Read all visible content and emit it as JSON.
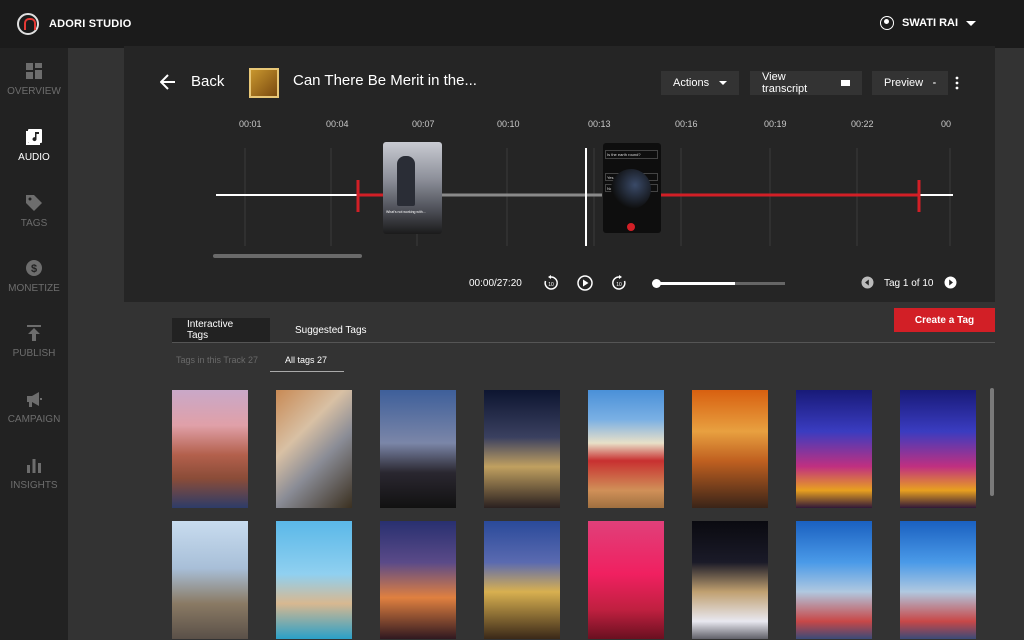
{
  "app": {
    "brand": "ADORI STUDIO",
    "user_name": "SWATI RAI"
  },
  "sidebar": {
    "items": [
      {
        "label": "OVERVIEW",
        "icon": "grid-icon",
        "active": false
      },
      {
        "label": "AUDIO",
        "icon": "music-note-icon",
        "active": true
      },
      {
        "label": "TAGS",
        "icon": "tag-icon",
        "active": false
      },
      {
        "label": "MONETIZE",
        "icon": "dollar-icon",
        "active": false
      },
      {
        "label": "PUBLISH",
        "icon": "upload-icon",
        "active": false
      },
      {
        "label": "CAMPAIGN",
        "icon": "megaphone-icon",
        "active": false
      },
      {
        "label": "INSIGHTS",
        "icon": "bar-chart-icon",
        "active": false
      }
    ]
  },
  "player": {
    "back_label": "Back",
    "episode_title": "Can There Be Merit in the...",
    "actions_label": "Actions",
    "transcript_label": "View transcript",
    "preview_label": "Preview",
    "time_ticks": [
      "00:01",
      "00:04",
      "00:07",
      "00:10",
      "00:13",
      "00:16",
      "00:19",
      "00:22",
      "00"
    ],
    "time_readout": "00:00/27:20",
    "tag_nav_label": "Tag 1 of 10",
    "progress_fraction": 0.0,
    "overlay_card_1_caption": "What's not working with...",
    "overlay_card_2_caption": "Is the earth round?",
    "overlay_card_2_option_1": "Yes",
    "overlay_card_2_option_2": "No"
  },
  "tabs": {
    "interactive_label": "Interactive Tags",
    "suggested_label": "Suggested Tags",
    "create_label": "Create a Tag",
    "sub_track_label": "Tags in this Track 27",
    "sub_all_label": "All tags  27"
  },
  "colors": {
    "accent": "#d21f26",
    "background": "#333333",
    "sidebar": "#222222",
    "topbar": "#1b1b1b"
  }
}
